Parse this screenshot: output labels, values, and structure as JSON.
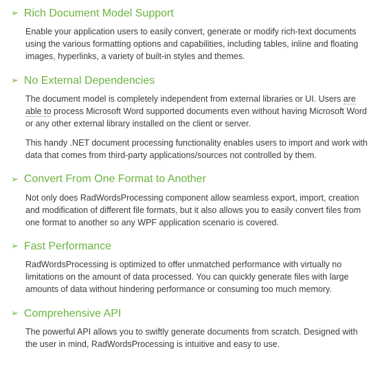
{
  "sections": [
    {
      "heading": "Rich Document Model Support",
      "paragraphs": [
        "Enable your application users to easily convert, generate or modify rich-text documents using the various formatting options and capabilities, including tables, inline and floating images, hyperlinks, a variety of built-in styles and themes."
      ]
    },
    {
      "heading": "No External Dependencies",
      "paragraphs": [
        "The document model is completely independent from external libraries or UI. Users are able to process Microsoft Word supported documents even without having Microsoft Word or any other external library installed on the client or server.",
        "This handy .NET document processing functionality enables users to import and work with data that comes from third-party applications/sources not controlled by them."
      ],
      "dotted_phrase": "are able to"
    },
    {
      "heading": "Convert From One Format to Another",
      "paragraphs": [
        "Not only does RadWordsProcessing component allow seamless export, import, creation and modification of different file formats, but it also allows you to easily convert files from one format to another so any WPF application scenario is covered."
      ]
    },
    {
      "heading": "Fast Performance",
      "paragraphs": [
        "RadWordsProcessing is optimized to offer unmatched performance with virtually no limitations on the amount of data processed. You can quickly generate files with large amounts of data without hindering performance or consuming too much memory."
      ]
    },
    {
      "heading": "Comprehensive API",
      "paragraphs": [
        "The powerful API allows you to swiftly generate documents from scratch. Designed with the user in mind, RadWordsProcessing is intuitive and easy to use."
      ]
    }
  ]
}
